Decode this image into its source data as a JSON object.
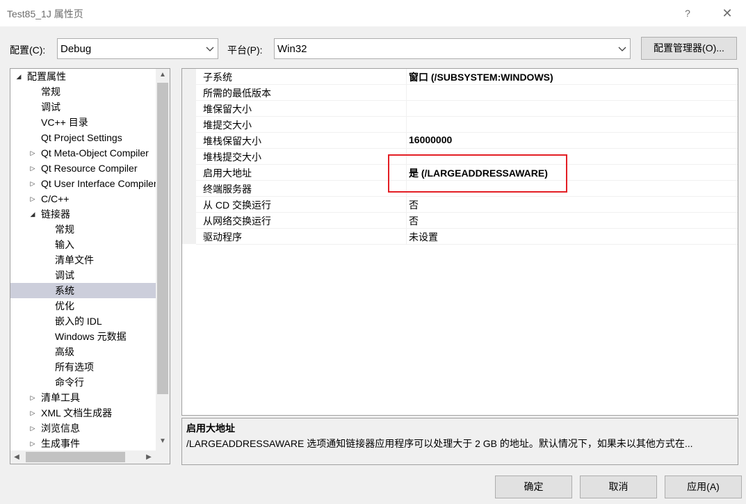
{
  "window": {
    "title": "Test85_1J 属性页",
    "help": "?",
    "close": "✕"
  },
  "config": {
    "config_label": "配置(C):",
    "config_value": "Debug",
    "platform_label": "平台(P):",
    "platform_value": "Win32",
    "manager_button": "配置管理器(O)..."
  },
  "tree": {
    "items": [
      {
        "label": "配置属性",
        "expander": "◢",
        "level": 0
      },
      {
        "label": "常规",
        "expander": "",
        "level": 1
      },
      {
        "label": "调试",
        "expander": "",
        "level": 1
      },
      {
        "label": "VC++ 目录",
        "expander": "",
        "level": 1
      },
      {
        "label": "Qt Project Settings",
        "expander": "",
        "level": 1
      },
      {
        "label": "Qt Meta-Object Compiler",
        "expander": "▷",
        "level": 1
      },
      {
        "label": "Qt Resource Compiler",
        "expander": "▷",
        "level": 1
      },
      {
        "label": "Qt User Interface Compiler",
        "expander": "▷",
        "level": 1
      },
      {
        "label": "C/C++",
        "expander": "▷",
        "level": 1
      },
      {
        "label": "链接器",
        "expander": "◢",
        "level": 1
      },
      {
        "label": "常规",
        "expander": "",
        "level": 2
      },
      {
        "label": "输入",
        "expander": "",
        "level": 2
      },
      {
        "label": "清单文件",
        "expander": "",
        "level": 2
      },
      {
        "label": "调试",
        "expander": "",
        "level": 2
      },
      {
        "label": "系统",
        "expander": "",
        "level": 2,
        "selected": true
      },
      {
        "label": "优化",
        "expander": "",
        "level": 2
      },
      {
        "label": "嵌入的 IDL",
        "expander": "",
        "level": 2
      },
      {
        "label": "Windows 元数据",
        "expander": "",
        "level": 2
      },
      {
        "label": "高级",
        "expander": "",
        "level": 2
      },
      {
        "label": "所有选项",
        "expander": "",
        "level": 2
      },
      {
        "label": "命令行",
        "expander": "",
        "level": 2
      },
      {
        "label": "清单工具",
        "expander": "▷",
        "level": 1
      },
      {
        "label": "XML 文档生成器",
        "expander": "▷",
        "level": 1
      },
      {
        "label": "浏览信息",
        "expander": "▷",
        "level": 1
      },
      {
        "label": "生成事件",
        "expander": "▷",
        "level": 1
      }
    ]
  },
  "properties": [
    {
      "name": "子系统",
      "value": "窗口 (/SUBSYSTEM:WINDOWS)",
      "bold": true
    },
    {
      "name": "所需的最低版本",
      "value": "",
      "bold": false
    },
    {
      "name": "堆保留大小",
      "value": "",
      "bold": false
    },
    {
      "name": "堆提交大小",
      "value": "",
      "bold": false
    },
    {
      "name": "堆栈保留大小",
      "value": "16000000",
      "bold": true
    },
    {
      "name": "堆栈提交大小",
      "value": "",
      "bold": false
    },
    {
      "name": "启用大地址",
      "value": "是 (/LARGEADDRESSAWARE)",
      "bold": true
    },
    {
      "name": "终端服务器",
      "value": "",
      "bold": false
    },
    {
      "name": "从 CD 交换运行",
      "value": "否",
      "bold": false
    },
    {
      "name": "从网络交换运行",
      "value": "否",
      "bold": false
    },
    {
      "name": "驱动程序",
      "value": "未设置",
      "bold": false
    }
  ],
  "description": {
    "title": "启用大地址",
    "text": "/LARGEADDRESSAWARE 选项通知链接器应用程序可以处理大于 2 GB 的地址。默认情况下，如果未以其他方式在..."
  },
  "buttons": {
    "ok": "确定",
    "cancel": "取消",
    "apply": "应用(A)"
  },
  "colors": {
    "highlight_border": "#e31e24",
    "selection": "#cccedb"
  }
}
